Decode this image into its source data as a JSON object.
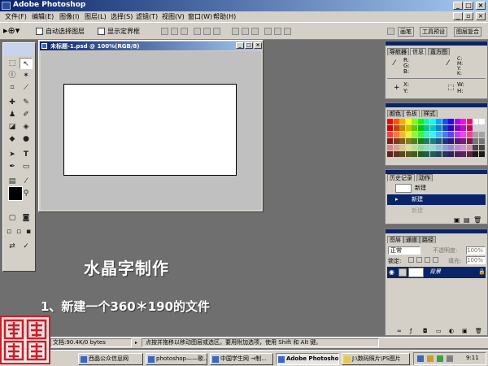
{
  "window": {
    "title": "Adobe Photoshop",
    "controls": [
      "_",
      "□",
      "×"
    ]
  },
  "menu": [
    "文件(F)",
    "编辑(E)",
    "图像(I)",
    "图层(L)",
    "选择(S)",
    "滤镜(T)",
    "视图(V)",
    "窗口(W)",
    "帮助(H)"
  ],
  "options": {
    "auto_select_label": "自动选择图层",
    "show_bounds_label": "显示定界框",
    "workspace_tabs": [
      "画笔",
      "工具预设",
      "图层复合"
    ]
  },
  "document": {
    "title": "未标题-1.psd @ 100%(RGB/8)"
  },
  "navigator": {
    "tabs": [
      "导航器",
      "信息",
      "直方图"
    ],
    "readouts": [
      "R:",
      "G:",
      "B:",
      "C:",
      "M:",
      "Y:",
      "K:",
      "X:",
      "Y:",
      "W:",
      "H:"
    ]
  },
  "swatches_panel": {
    "tabs": [
      "颜色",
      "色板",
      "样式"
    ]
  },
  "history": {
    "tabs": [
      "历史记录",
      "动作"
    ],
    "snapshot": "新建",
    "items": [
      "新建",
      "新建"
    ]
  },
  "layers": {
    "tabs": [
      "图层",
      "通道",
      "路径"
    ],
    "blend_mode": "正常",
    "opacity_label": "不透明度:",
    "opacity_value": "100%",
    "lock_label": "锁定:",
    "fill_label": "填充:",
    "fill_value": "100%",
    "layer_name": "背景"
  },
  "overlay": {
    "heading": "水晶字制作",
    "step": "1、新建一个360＊190的文件"
  },
  "status": {
    "zoom": "100%",
    "doc_size": "文档:90.4K/0 bytes",
    "hint": "点按并拖移以移动图层或选区。要用附加选项，使用 Shift 和 Alt 键。"
  },
  "taskbar": {
    "tasks": [
      "西晶公众信息网",
      "photoshop——歌...",
      "中国学生网 →制...",
      "Adobe Photoshop",
      "J:\\数码照片\\PS图片"
    ],
    "clock": "9:11"
  },
  "seal": {
    "text": "藍品"
  },
  "colors": {
    "titlebar": "#0a246a",
    "workspace": "#6f6f6f",
    "panel": "#d4d0c8",
    "highlight": "#0a246a"
  }
}
